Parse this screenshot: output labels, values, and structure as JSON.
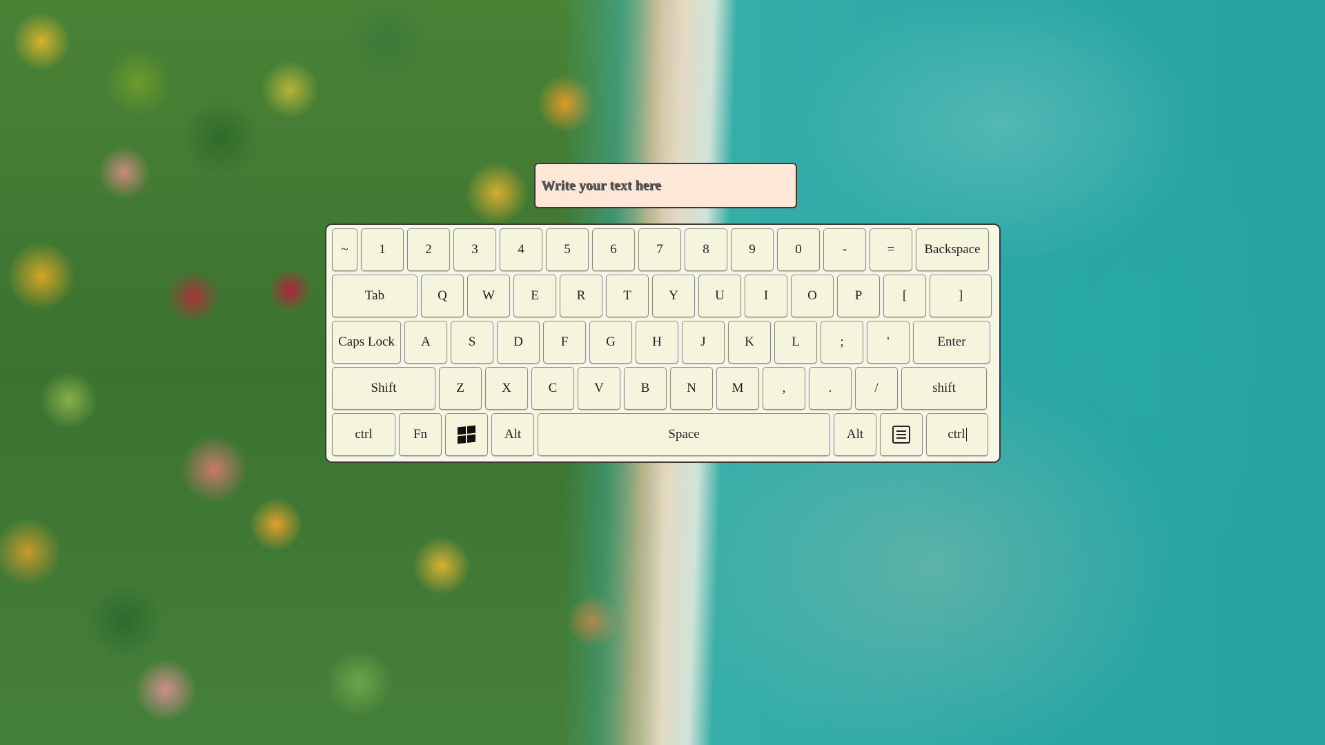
{
  "input": {
    "placeholder": "Write your text here",
    "value": ""
  },
  "keyboard": {
    "row1": [
      "~",
      "1",
      "2",
      "3",
      "4",
      "5",
      "6",
      "7",
      "8",
      "9",
      "0",
      "-",
      "=",
      "Backspace"
    ],
    "row2": [
      "Tab",
      "Q",
      "W",
      "E",
      "R",
      "T",
      "Y",
      "U",
      "I",
      "O",
      "P",
      "[",
      "]"
    ],
    "row3": [
      "Caps Lock",
      "A",
      "S",
      "D",
      "F",
      "G",
      "H",
      "J",
      "K",
      "L",
      ";",
      "'",
      "Enter"
    ],
    "row4": [
      "Shift",
      "Z",
      "X",
      "C",
      "V",
      "B",
      "N",
      "M",
      ",",
      ".",
      "/",
      "shift"
    ],
    "row5": {
      "ctrl_left": "ctrl",
      "fn": "Fn",
      "windows_icon": "windows-logo-icon",
      "alt_left": "Alt",
      "space": "Space",
      "alt_right": "Alt",
      "menu_icon": "context-menu-icon",
      "ctrl_right": "ctrl"
    }
  },
  "colors": {
    "keyboard_bg": "#f7f7e6",
    "key_bg": "#f5f5de",
    "input_bg": "#fde7d6",
    "border": "#3a3a3a"
  }
}
